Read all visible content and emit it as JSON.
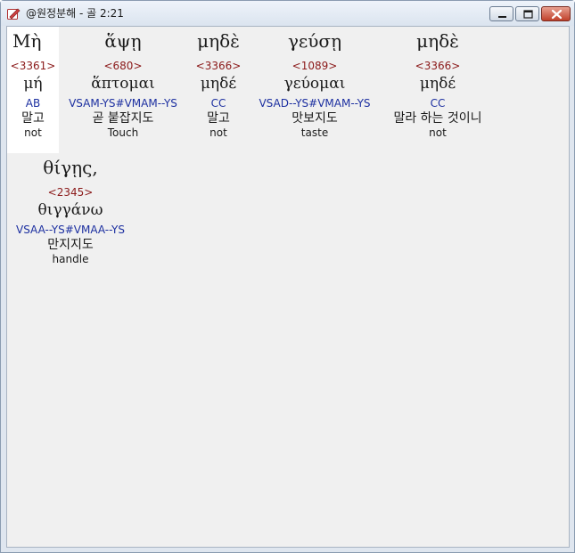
{
  "window": {
    "title": "@원정분해 - 골 2:21"
  },
  "row1": [
    {
      "greek": "Μὴ",
      "strong": "<3361>",
      "lemma": "μή",
      "parse": "AB",
      "korean": "말고",
      "english": "not"
    },
    {
      "greek": "ἅψῃ",
      "strong": "<680>",
      "lemma": "ἅπτομαι",
      "parse": "VSAM-YS#VMAM--YS",
      "korean": "곧 붙잡지도",
      "english": "Touch"
    },
    {
      "greek": "μηδὲ",
      "strong": "<3366>",
      "lemma": "μηδέ",
      "parse": "CC",
      "korean": "말고",
      "english": "not"
    },
    {
      "greek": "γεύσῃ",
      "strong": "<1089>",
      "lemma": "γεύομαι",
      "parse": "VSAD--YS#VMAM--YS",
      "korean": "맛보지도",
      "english": "taste"
    },
    {
      "greek": "μηδὲ",
      "strong": "<3366>",
      "lemma": "μηδέ",
      "parse": "CC",
      "korean": "말라 하는 것이니",
      "english": "not"
    }
  ],
  "row2": [
    {
      "greek": "θίγῃς,",
      "strong": "<2345>",
      "lemma": "θιγγάνω",
      "parse": "VSAA--YS#VMAA--YS",
      "korean": "만지지도",
      "english": "handle"
    }
  ]
}
